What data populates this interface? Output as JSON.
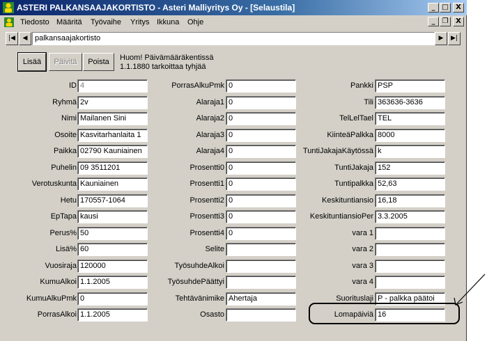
{
  "window": {
    "title": "ASTERI PALKANSAAJAKORTISTO - Asteri Malliyritys Oy - [Selaustila]",
    "minimize": "_",
    "maximize": "□",
    "close": "X"
  },
  "menu": {
    "items": [
      "Tiedosto",
      "Määritä",
      "Työvaihe",
      "Yritys",
      "Ikkuna",
      "Ohje"
    ],
    "mdi_minimize": "_",
    "mdi_restore": "❐",
    "mdi_close": "X"
  },
  "nav": {
    "first": "|◀",
    "prev": "◀",
    "next": "▶",
    "last": "▶|",
    "record_name": "palkansaajakortisto"
  },
  "actions": {
    "add": "Lisää",
    "update": "Päivitä",
    "delete": "Poista"
  },
  "notice": {
    "line1": "Huom! Päivämääräkentissä",
    "line2": "1.1.1880 tarkoittaa tyhjää"
  },
  "col1": [
    {
      "label": "ID",
      "value": "4"
    },
    {
      "label": "Ryhmä",
      "value": "2v"
    },
    {
      "label": "Nimi",
      "value": "Mailanen Sini"
    },
    {
      "label": "Osoite",
      "value": "Kasvitarhanlaita 1"
    },
    {
      "label": "Paikka",
      "value": "02790 Kauniainen"
    },
    {
      "label": "Puhelin",
      "value": "09 3511201"
    },
    {
      "label": "Verotuskunta",
      "value": "Kauniainen"
    },
    {
      "label": "Hetu",
      "value": "170557-1064"
    },
    {
      "label": "EpTapa",
      "value": "kausi"
    },
    {
      "label": "Perus%",
      "value": "50"
    },
    {
      "label": "Lisä%",
      "value": "60"
    },
    {
      "label": "Vuosiraja",
      "value": "120000"
    },
    {
      "label": "KumuAlkoi",
      "value": "1.1.2005"
    },
    {
      "label": "KumuAlkuPmk",
      "value": "0"
    },
    {
      "label": "PorrasAlkoi",
      "value": "1.1.2005"
    }
  ],
  "col2": [
    {
      "label": "PorrasAlkuPmk",
      "value": "0"
    },
    {
      "label": "Alaraja1",
      "value": "0"
    },
    {
      "label": "Alaraja2",
      "value": "0"
    },
    {
      "label": "Alaraja3",
      "value": "0"
    },
    {
      "label": "Alaraja4",
      "value": "0"
    },
    {
      "label": "Prosentti0",
      "value": "0"
    },
    {
      "label": "Prosentti1",
      "value": "0"
    },
    {
      "label": "Prosentti2",
      "value": "0"
    },
    {
      "label": "Prosentti3",
      "value": "0"
    },
    {
      "label": "Prosentti4",
      "value": "0"
    },
    {
      "label": "Selite",
      "value": ""
    },
    {
      "label": "TyösuhdeAlkoi",
      "value": ""
    },
    {
      "label": "TyösuhdePäättyi",
      "value": ""
    },
    {
      "label": "Tehtävänimike",
      "value": "Ahertaja"
    },
    {
      "label": "Osasto",
      "value": ""
    }
  ],
  "col3": [
    {
      "label": "Pankki",
      "value": "PSP"
    },
    {
      "label": "Tili",
      "value": "363636-3636"
    },
    {
      "label": "TelLelTael",
      "value": "TEL"
    },
    {
      "label": "KiinteäPalkka",
      "value": "8000"
    },
    {
      "label": "TuntiJakajaKäytössä",
      "value": "k"
    },
    {
      "label": "TuntiJakaja",
      "value": "152"
    },
    {
      "label": "Tuntipalkka",
      "value": "52,63"
    },
    {
      "label": "Keskituntiansio",
      "value": "16,18"
    },
    {
      "label": "KeskituntiansioPer",
      "value": "3.3.2005"
    },
    {
      "label": "vara 1",
      "value": ""
    },
    {
      "label": "vara 2",
      "value": ""
    },
    {
      "label": "vara 3",
      "value": ""
    },
    {
      "label": "vara 4",
      "value": ""
    },
    {
      "label": "Suorituslaji",
      "value": "P    - palkka päätoi"
    },
    {
      "label": "Lomapäiviä",
      "value": "16"
    }
  ]
}
